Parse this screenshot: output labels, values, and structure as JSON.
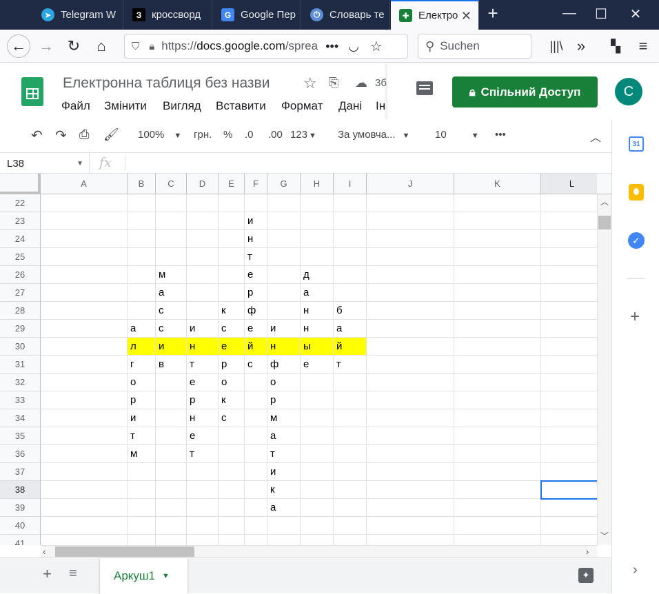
{
  "browser": {
    "tabs": [
      {
        "label": "Telegram W",
        "icon": "telegram-icon",
        "color": "#2ca5e0"
      },
      {
        "label": "кроссворд",
        "icon": "z-icon",
        "color": "#000000"
      },
      {
        "label": "Google Пер",
        "icon": "google-translate-icon",
        "color": "#4285f4"
      },
      {
        "label": "Словарь те",
        "icon": "power-icon",
        "color": "#5b8dd9"
      },
      {
        "label": "Електро",
        "icon": "sheets-icon",
        "color": "#188038"
      }
    ],
    "url_prefix": "https://",
    "url_main": "docs.google.com",
    "url_rest": "/sprea",
    "search_placeholder": "Suchen"
  },
  "sheet": {
    "title": "Електронна таблиця без назви",
    "save_status": "3б",
    "menu": [
      "Файл",
      "Змінити",
      "Вигляд",
      "Вставити",
      "Формат",
      "Дані",
      "Ін"
    ],
    "share_label": "Спільний Доступ",
    "avatar_letter": "С"
  },
  "toolbar": {
    "zoom": "100%",
    "currency": "грн.",
    "percent": "%",
    "dec_less": ".0",
    "dec_more": ".00",
    "number_format": "123",
    "font": "За умовча...",
    "font_size": "10",
    "more": "•••"
  },
  "formula_bar": {
    "cell_ref": "L38",
    "fx": "fx",
    "value": ""
  },
  "grid": {
    "columns": [
      "A",
      "B",
      "C",
      "D",
      "E",
      "F",
      "G",
      "H",
      "I",
      "J",
      "K",
      "L"
    ],
    "rows": [
      22,
      23,
      24,
      25,
      26,
      27,
      28,
      29,
      30,
      31,
      32,
      33,
      34,
      35,
      36,
      37,
      38,
      39,
      40,
      41
    ],
    "cells": [
      {
        "r": 23,
        "c": "F",
        "v": "и"
      },
      {
        "r": 24,
        "c": "F",
        "v": "н"
      },
      {
        "r": 25,
        "c": "F",
        "v": "т"
      },
      {
        "r": 26,
        "c": "C",
        "v": "м"
      },
      {
        "r": 26,
        "c": "F",
        "v": "е"
      },
      {
        "r": 26,
        "c": "H",
        "v": "д"
      },
      {
        "r": 27,
        "c": "C",
        "v": "а"
      },
      {
        "r": 27,
        "c": "F",
        "v": "р"
      },
      {
        "r": 27,
        "c": "H",
        "v": "а"
      },
      {
        "r": 28,
        "c": "C",
        "v": "с"
      },
      {
        "r": 28,
        "c": "E",
        "v": "к"
      },
      {
        "r": 28,
        "c": "F",
        "v": "ф"
      },
      {
        "r": 28,
        "c": "H",
        "v": "н"
      },
      {
        "r": 28,
        "c": "I",
        "v": "б"
      },
      {
        "r": 29,
        "c": "B",
        "v": "а"
      },
      {
        "r": 29,
        "c": "C",
        "v": "с"
      },
      {
        "r": 29,
        "c": "D",
        "v": "и"
      },
      {
        "r": 29,
        "c": "E",
        "v": "с"
      },
      {
        "r": 29,
        "c": "F",
        "v": "е"
      },
      {
        "r": 29,
        "c": "G",
        "v": "и"
      },
      {
        "r": 29,
        "c": "H",
        "v": "н"
      },
      {
        "r": 29,
        "c": "I",
        "v": "а"
      },
      {
        "r": 30,
        "c": "B",
        "v": "л"
      },
      {
        "r": 30,
        "c": "C",
        "v": "и"
      },
      {
        "r": 30,
        "c": "D",
        "v": "н"
      },
      {
        "r": 30,
        "c": "E",
        "v": "е"
      },
      {
        "r": 30,
        "c": "F",
        "v": "й"
      },
      {
        "r": 30,
        "c": "G",
        "v": "н"
      },
      {
        "r": 30,
        "c": "H",
        "v": "ы"
      },
      {
        "r": 30,
        "c": "I",
        "v": "й"
      },
      {
        "r": 31,
        "c": "B",
        "v": "г"
      },
      {
        "r": 31,
        "c": "C",
        "v": "в"
      },
      {
        "r": 31,
        "c": "D",
        "v": "т"
      },
      {
        "r": 31,
        "c": "E",
        "v": "р"
      },
      {
        "r": 31,
        "c": "F",
        "v": "с"
      },
      {
        "r": 31,
        "c": "G",
        "v": "ф"
      },
      {
        "r": 31,
        "c": "H",
        "v": "е"
      },
      {
        "r": 31,
        "c": "I",
        "v": "т"
      },
      {
        "r": 32,
        "c": "B",
        "v": "о"
      },
      {
        "r": 32,
        "c": "D",
        "v": "е"
      },
      {
        "r": 32,
        "c": "E",
        "v": "о"
      },
      {
        "r": 32,
        "c": "G",
        "v": "о"
      },
      {
        "r": 33,
        "c": "B",
        "v": "р"
      },
      {
        "r": 33,
        "c": "D",
        "v": "р"
      },
      {
        "r": 33,
        "c": "E",
        "v": "к"
      },
      {
        "r": 33,
        "c": "G",
        "v": "р"
      },
      {
        "r": 34,
        "c": "B",
        "v": "и"
      },
      {
        "r": 34,
        "c": "D",
        "v": "н"
      },
      {
        "r": 34,
        "c": "E",
        "v": "с"
      },
      {
        "r": 34,
        "c": "G",
        "v": "м"
      },
      {
        "r": 35,
        "c": "B",
        "v": "т"
      },
      {
        "r": 35,
        "c": "D",
        "v": "е"
      },
      {
        "r": 35,
        "c": "G",
        "v": "а"
      },
      {
        "r": 36,
        "c": "B",
        "v": "м"
      },
      {
        "r": 36,
        "c": "D",
        "v": "т"
      },
      {
        "r": 36,
        "c": "G",
        "v": "т"
      },
      {
        "r": 37,
        "c": "G",
        "v": "и"
      },
      {
        "r": 38,
        "c": "G",
        "v": "к"
      },
      {
        "r": 39,
        "c": "G",
        "v": "а"
      }
    ],
    "highlight_row": 30,
    "highlight_color": "#ffff00",
    "selected_cell": "L38"
  },
  "sheets_bar": {
    "active_sheet": "Аркуш1"
  }
}
